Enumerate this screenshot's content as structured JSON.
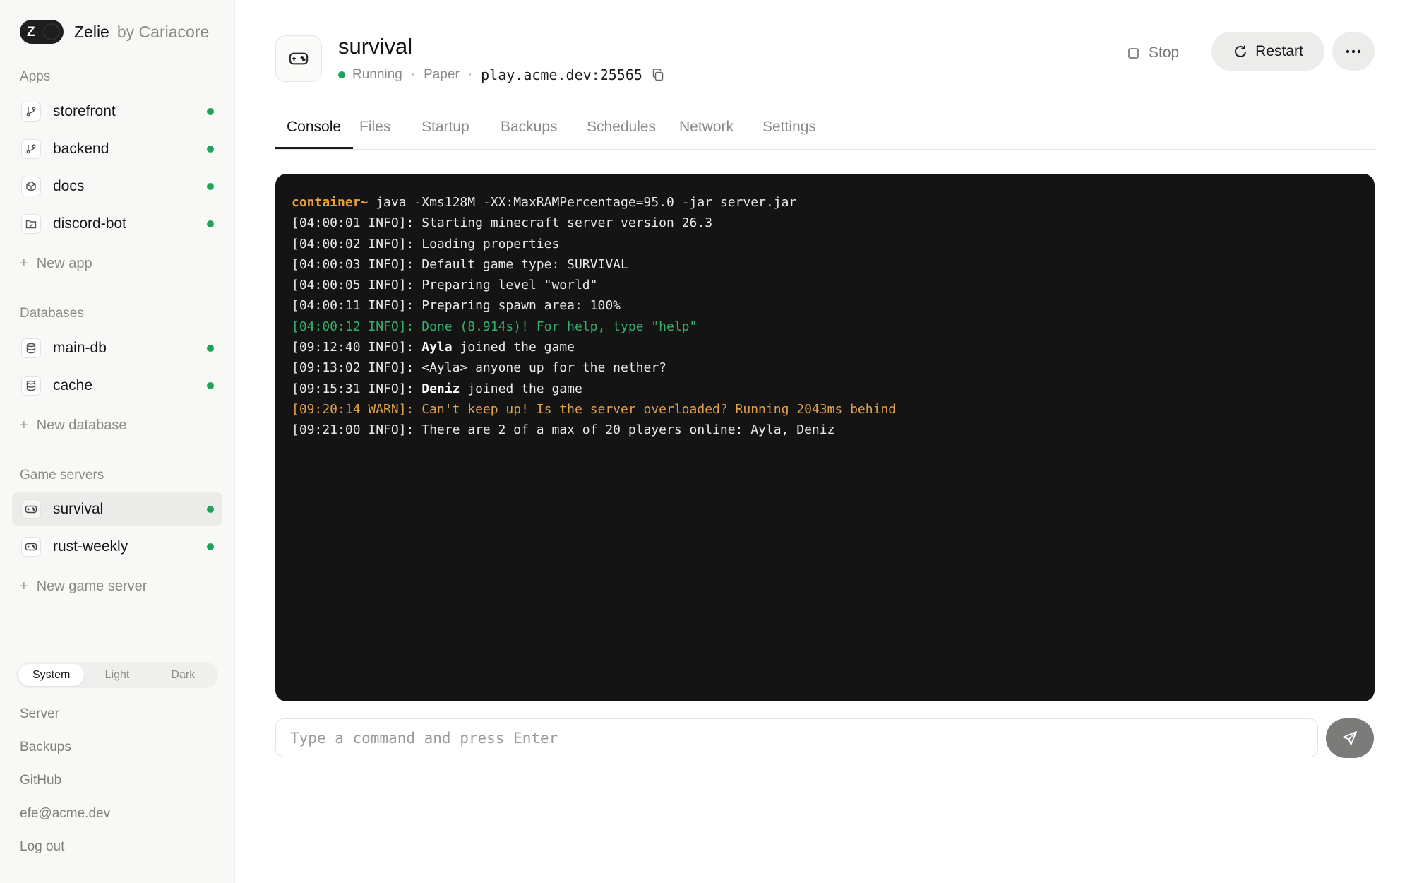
{
  "brand": {
    "logo_letter": "Z",
    "name": "Zelie",
    "by": "by Cariacore"
  },
  "sidebar": {
    "apps_title": "Apps",
    "apps": [
      {
        "label": "storefront",
        "icon": "git-branch-icon",
        "status": "online"
      },
      {
        "label": "backend",
        "icon": "git-branch-icon",
        "status": "online"
      },
      {
        "label": "docs",
        "icon": "package-icon",
        "status": "online"
      },
      {
        "label": "discord-bot",
        "icon": "folder-icon",
        "status": "online"
      }
    ],
    "new_app": "New app",
    "databases_title": "Databases",
    "databases": [
      {
        "label": "main-db",
        "icon": "database-icon",
        "status": "online"
      },
      {
        "label": "cache",
        "icon": "database-icon",
        "status": "online"
      }
    ],
    "new_database": "New database",
    "game_servers_title": "Game servers",
    "game_servers": [
      {
        "label": "survival",
        "icon": "gamepad-icon",
        "status": "online",
        "active": true
      },
      {
        "label": "rust-weekly",
        "icon": "gamepad-icon",
        "status": "online"
      }
    ],
    "new_game_server": "New game server",
    "theme": {
      "options": [
        "System",
        "Light",
        "Dark"
      ],
      "selected": "System"
    },
    "footer": {
      "server": "Server",
      "backups": "Backups",
      "github": "GitHub",
      "email": "efe@acme.dev",
      "logout": "Log out"
    }
  },
  "header": {
    "title": "survival",
    "status": "Running",
    "separator": "·",
    "software": "Paper",
    "address": "play.acme.dev:25565",
    "stop_label": "Stop",
    "restart_label": "Restart",
    "more_label": "···"
  },
  "tabs": [
    "Console",
    "Files",
    "Startup",
    "Backups",
    "Schedules",
    "Network",
    "Settings"
  ],
  "active_tab": "Console",
  "console": {
    "prompt": "container~",
    "command": " java -Xms128M -XX:MaxRAMPercentage=95.0 -jar server.jar",
    "lines": [
      {
        "text": "[04:00:01 INFO]: Starting minecraft server version 26.3",
        "kind": "normal"
      },
      {
        "text": "[04:00:02 INFO]: Loading properties",
        "kind": "normal"
      },
      {
        "text": "[04:00:03 INFO]: Default game type: SURVIVAL",
        "kind": "normal"
      },
      {
        "text": "[04:00:05 INFO]: Preparing level \"world\"",
        "kind": "normal"
      },
      {
        "text": "[04:00:11 INFO]: Preparing spawn area: 100%",
        "kind": "normal"
      },
      {
        "text": "[04:00:12 INFO]: Done (8.914s)! For help, type \"help\"",
        "kind": "green"
      },
      {
        "prefix": "[09:12:40 INFO]: ",
        "bold": "Ayla",
        "suffix": " joined the game",
        "kind": "normal"
      },
      {
        "text": "[09:13:02 INFO]: <Ayla> anyone up for the nether?",
        "kind": "normal"
      },
      {
        "prefix": "[09:15:31 INFO]: ",
        "bold": "Deniz",
        "suffix": " joined the game",
        "kind": "normal"
      },
      {
        "text": "[09:20:14 WARN]: Can't keep up! Is the server overloaded? Running 2043ms behind",
        "kind": "warn"
      },
      {
        "text": "[09:21:00 INFO]: There are 2 of a max of 20 players online: Ayla, Deniz",
        "kind": "normal"
      }
    ]
  },
  "command_input": {
    "placeholder": "Type a command and press Enter",
    "value": ""
  },
  "colors": {
    "online": "#22a35a",
    "warn": "#e3a24a",
    "success": "#35b06a",
    "prompt": "#e7a33e",
    "console_bg": "#141414"
  }
}
